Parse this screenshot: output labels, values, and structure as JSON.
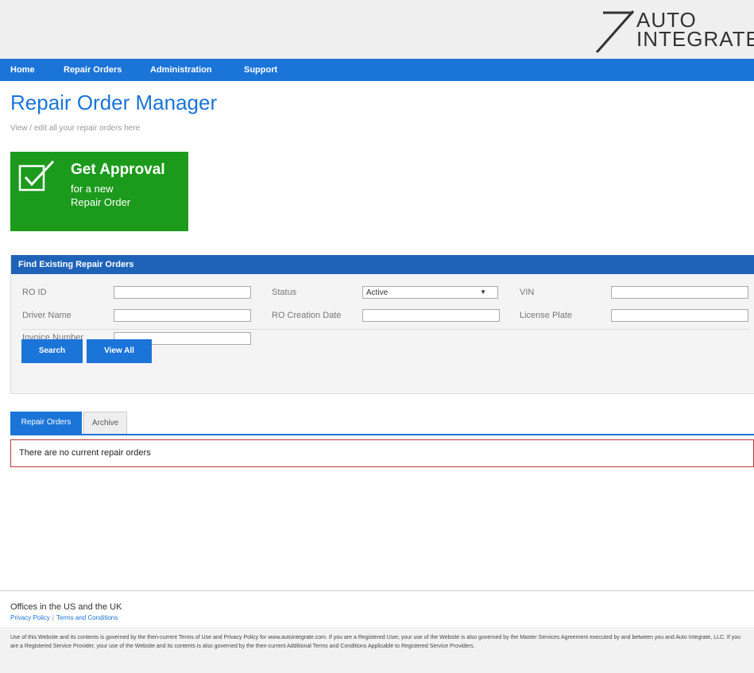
{
  "logo": {
    "line1": "AUTO",
    "line2": "INTEGRATE"
  },
  "nav": {
    "items": [
      "Home",
      "Repair Orders",
      "Administration",
      "Support"
    ]
  },
  "page": {
    "title": "Repair Order Manager",
    "subtitle": "View / edit all your repair orders here"
  },
  "approval": {
    "title": "Get Approval",
    "line2": "for a new",
    "line3": "Repair Order",
    "icon": "checkbox-check-icon",
    "color": "#1c9a1c"
  },
  "search_panel": {
    "header": "Find Existing Repair Orders",
    "fields": {
      "ro_id": {
        "label": "RO ID",
        "value": ""
      },
      "status": {
        "label": "Status",
        "value": "Active"
      },
      "vin": {
        "label": "VIN",
        "value": ""
      },
      "driver_name": {
        "label": "Driver Name",
        "value": ""
      },
      "ro_creation_date": {
        "label": "RO Creation Date",
        "value": ""
      },
      "license_plate": {
        "label": "License Plate",
        "value": ""
      },
      "invoice_number": {
        "label": "Invoice Number",
        "value": ""
      }
    },
    "buttons": {
      "search": "Search",
      "view_all": "View All"
    }
  },
  "tabs": {
    "repair_orders": "Repair Orders",
    "archive": "Archive"
  },
  "empty_message": "There are no current repair orders",
  "footer": {
    "offices": "Offices in the US and the UK",
    "privacy": "Privacy Policy",
    "separator": "|",
    "terms": "Terms and Conditions",
    "legal": "Use of this Website and its contents is governed by the then-current Terms of Use and Privacy Policy for www.autointegrate.com. If you are a Registered User, your use of the Website is also governed by the Master Services Agreement executed by and between you and Auto Integrate, LLC. If you are a Registered Service Provider, your use of the Website and its contents is also governed by the then-current Additional Terms and Conditions Applicable to Registered Service Providers."
  },
  "colors": {
    "brand_blue": "#1b74d8",
    "panel_header": "#1e63b8",
    "approval_green": "#1c9a1c",
    "error_border": "#b83a3a"
  }
}
